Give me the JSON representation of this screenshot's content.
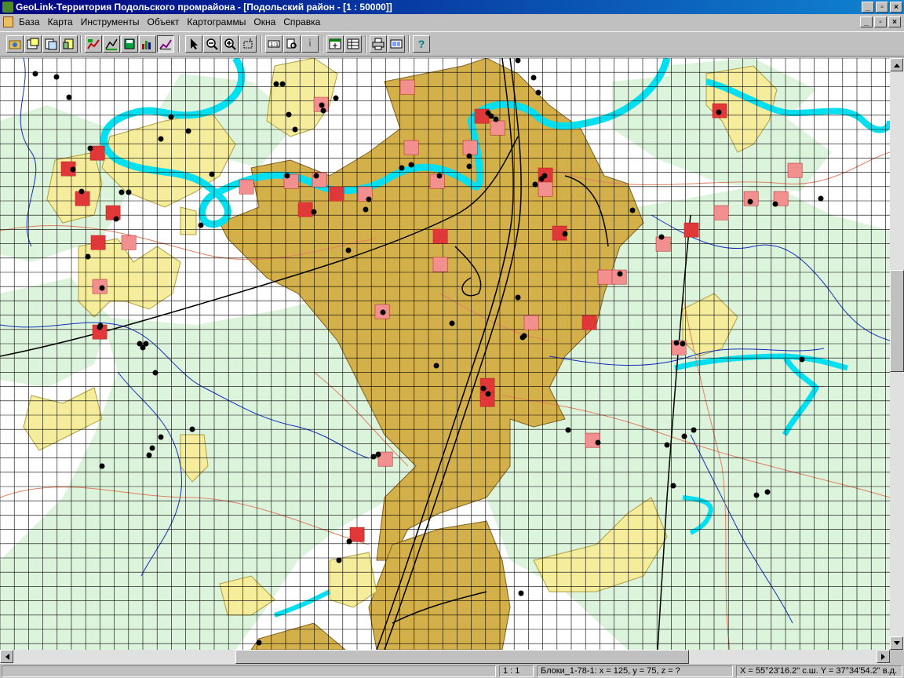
{
  "window": {
    "title": "GeoLink-Территория Подольского промрайона - [Подольский район - [1 : 50000]]",
    "min_glyph": "_",
    "max_glyph": "▫",
    "close_glyph": "×"
  },
  "menu": {
    "items": [
      "База",
      "Карта",
      "Инструменты",
      "Объект",
      "Картограммы",
      "Окна",
      "Справка"
    ]
  },
  "toolbar": {
    "info_glyph": "i",
    "help_glyph": "?"
  },
  "map": {
    "colors": {
      "urban": "#d4b04a",
      "settlement": "#f5ec9c",
      "forest": "#dcf3dc",
      "river": "#00e0f0",
      "grid": "#000000",
      "block_dark": "#e03838",
      "block_light": "#f29090",
      "road": "#e08060",
      "stream": "#1030c0"
    }
  },
  "statusbar": {
    "scale": "1 : 1",
    "block_info": "Блоки_1-78-1: x = 125, y = 75, z = ?",
    "coords": "X = 55°23'16.2\" с.ш.  Y = 37°34'54.2\" в.д."
  }
}
